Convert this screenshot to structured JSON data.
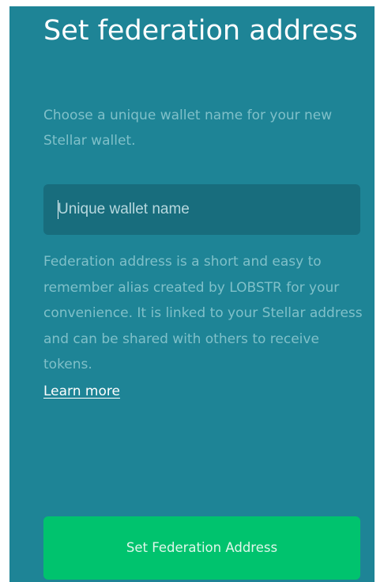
{
  "header": {
    "title": "Set federation address"
  },
  "intro": {
    "text": "Choose a unique wallet name for your new Stellar wallet."
  },
  "wallet_name_input": {
    "placeholder": "Unique wallet name",
    "value": ""
  },
  "info": {
    "text": "Federation address is a short and easy to remember alias created by LOBSTR for your convenience. It is linked to your Stellar address and can be shared with others to receive tokens.",
    "link_label": "Learn more"
  },
  "actions": {
    "primary_label": "Set Federation Address"
  },
  "colors": {
    "background": "#1e8496",
    "input_background": "#186d7d",
    "muted_text": "#7fc0c9",
    "primary_button": "#00c36e"
  }
}
